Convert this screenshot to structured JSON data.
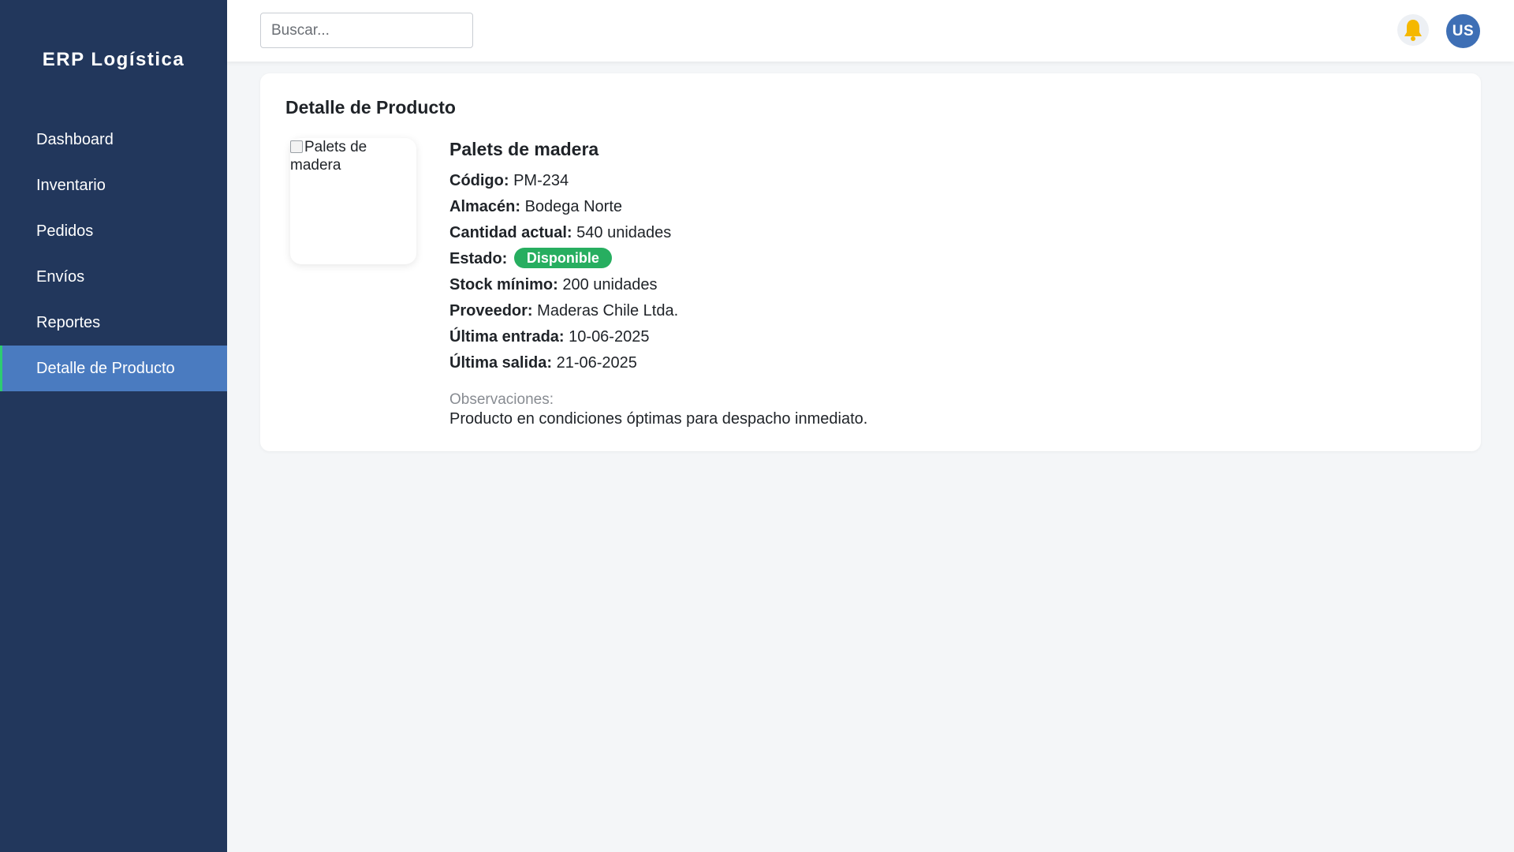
{
  "sidebar": {
    "brand": "ERP Logística",
    "items": [
      {
        "label": "Dashboard"
      },
      {
        "label": "Inventario"
      },
      {
        "label": "Pedidos"
      },
      {
        "label": "Envíos"
      },
      {
        "label": "Reportes"
      },
      {
        "label": "Detalle de Producto",
        "active": true
      }
    ]
  },
  "header": {
    "search_placeholder": "Buscar...",
    "notification_icon": "bell-icon",
    "avatar_initials": "US"
  },
  "main": {
    "card_title": "Detalle de Producto",
    "image_alt": "Palets de madera",
    "product": {
      "name": "Palets de madera",
      "fields": [
        {
          "label": "Código:",
          "value": "PM-234"
        },
        {
          "label": "Almacén:",
          "value": "Bodega Norte"
        },
        {
          "label": "Cantidad actual:",
          "value": "540 unidades"
        },
        {
          "label": "Estado:",
          "value": "Disponible",
          "badge": true
        },
        {
          "label": "Stock mínimo:",
          "value": "200 unidades"
        },
        {
          "label": "Proveedor:",
          "value": "Maderas Chile Ltda."
        },
        {
          "label": "Última entrada:",
          "value": "10-06-2025"
        },
        {
          "label": "Última salida:",
          "value": "21-06-2025"
        }
      ],
      "observations_label": "Observaciones:",
      "observations_text": "Producto en condiciones óptimas para despacho inmediato."
    }
  },
  "colors": {
    "sidebar_bg": "#22375c",
    "active_item": "#4a7bc0",
    "active_border": "#2ecc71",
    "badge_green": "#27ae60",
    "avatar_bg": "#3e6fb5",
    "bell_yellow": "#f5b800"
  }
}
